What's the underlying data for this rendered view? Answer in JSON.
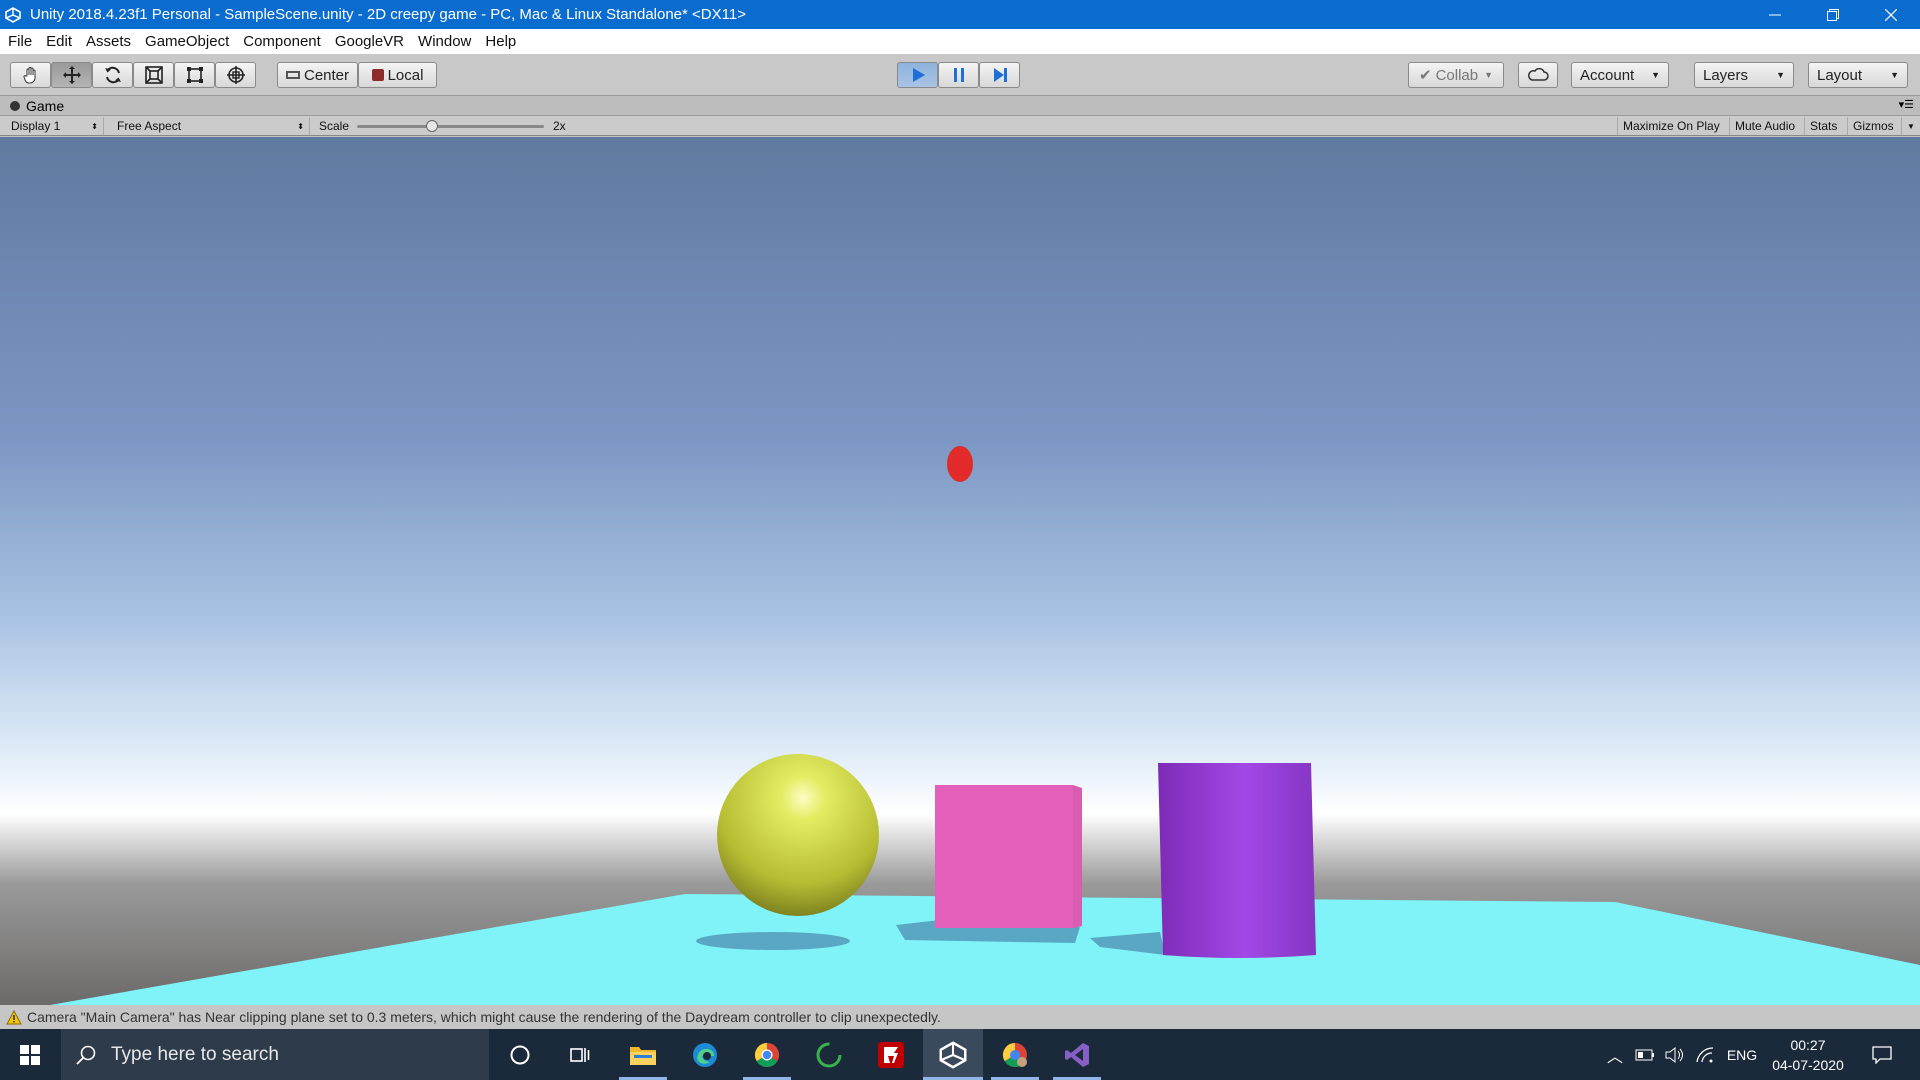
{
  "window": {
    "title": "Unity 2018.4.23f1 Personal - SampleScene.unity - 2D creepy game - PC, Mac & Linux Standalone* <DX11>",
    "icon": "unity-icon",
    "controls": [
      "minimize-icon",
      "restore-icon",
      "close-icon"
    ]
  },
  "menu": {
    "items": [
      "File",
      "Edit",
      "Assets",
      "GameObject",
      "Component",
      "GoogleVR",
      "Window",
      "Help"
    ]
  },
  "toolbar": {
    "tools": [
      "hand-icon",
      "move-icon",
      "rotate-icon",
      "scale-icon",
      "rect-icon",
      "transform-icon"
    ],
    "pivot_label": "Center",
    "space_label": "Local",
    "play_state": "playing",
    "collab_label": "Collab",
    "account_label": "Account",
    "layers_label": "Layers",
    "layout_label": "Layout"
  },
  "game_panel": {
    "tab_label": "Game",
    "display": "Display 1",
    "aspect": "Free Aspect",
    "scale_label": "Scale",
    "scale_value": "2x",
    "scale_level": 0.4,
    "buttons": [
      "Maximize On Play",
      "Mute Audio",
      "Stats",
      "Gizmos"
    ]
  },
  "scene": {
    "objects": [
      "sphere",
      "cube",
      "cylinder",
      "plane",
      "pointer-dot"
    ],
    "colors": {
      "sphere": "#c9d23a",
      "cube": "#e35fb9",
      "cylinder": "#9a3fd6",
      "plane": "#7ff3f7",
      "dot": "#e22a2a"
    }
  },
  "status": {
    "message": "Camera \"Main Camera\" has Near clipping plane set to 0.3 meters, which might cause the rendering of the Daydream controller to clip unexpectedly."
  },
  "taskbar": {
    "search_placeholder": "Type here to search",
    "apps": [
      "windows-start-icon",
      "cortana-icon",
      "task-view-icon",
      "file-explorer-icon",
      "edge-icon",
      "chrome-icon",
      "sync-app-icon",
      "filezilla-icon",
      "unity-icon",
      "chrome-profile-icon",
      "visual-studio-icon"
    ],
    "language": "ENG",
    "time": "00:27",
    "date": "04-07-2020"
  }
}
